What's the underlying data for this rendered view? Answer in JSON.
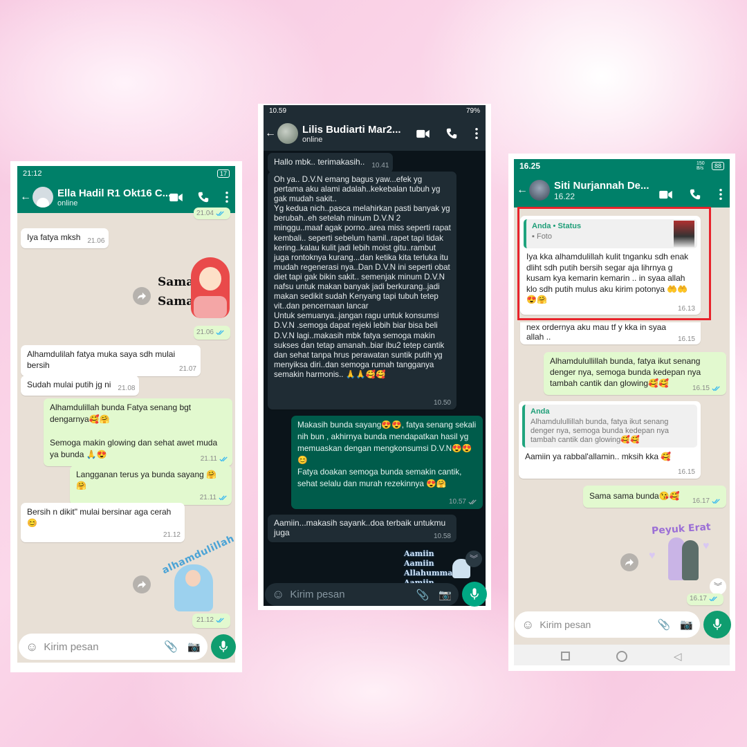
{
  "panel1": {
    "status_time": "21:12",
    "battery": "17",
    "contact": "Ella Hadil R1 Okt16 C...",
    "presence": "online",
    "messages": [
      {
        "time": "21.04"
      },
      {
        "text": "Iya fatya mksh",
        "time": "21.06"
      },
      {
        "sticker_text": "Sama Sama",
        "time": "21.06"
      },
      {
        "text": "Alhamdulilah fatya muka saya sdh mulai bersih",
        "time": "21.07"
      },
      {
        "text": "Sudah mulai putih jg ni",
        "time": "21.08"
      },
      {
        "text": "Alhamdulillah bunda Fatya senang bgt dengarnya🥰🤗\n\nSemoga makin glowing dan sehat awet muda ya bunda 🙏😍",
        "time": "21.11"
      },
      {
        "text": "Langganan terus ya bunda sayang 🤗🤗",
        "time": "21.11"
      },
      {
        "text": "Bersih n dikit\" mulai bersinar aga cerah 😊",
        "time": "21.12"
      },
      {
        "sticker_text": "alhamdulillah",
        "time": "21.12"
      }
    ],
    "input_placeholder": "Kirim pesan"
  },
  "panel2": {
    "status_time": "10.59",
    "battery": "79%",
    "contact": "Lilis Budiarti Mar2...",
    "presence": "online",
    "messages": [
      {
        "text": "Hallo mbk.. terimakasih..",
        "time": "10.41"
      },
      {
        "text": "Oh ya.. D.V.N emang bagus yaw...efek yg pertama aku alami adalah..kekebalan tubuh yg gak mudah sakit..\nYg kedua nich..pasca melahirkan pasti banyak yg berubah..eh setelah minum D.V.N 2 minggu..maaf agak porno..area miss seperti rapat kembali.. seperti sebelum hamil..rapet tapi tidak kering..kalau kulit jadi lebih moist gitu..rambut juga rontoknya kurang...dan ketika kita terluka itu mudah regenerasi nya..Dan D.V.N ini seperti obat diet tapi gak bikin sakit.. semenjak minum D.V.N nafsu untuk makan banyak jadi berkurang..jadi makan sedikit sudah Kenyang tapi tubuh tetep vit..dan pencernaan lancar\nUntuk semuanya..jangan ragu untuk konsumsi D.V.N .semoga dapat rejeki lebih biar bisa beli D.V.N lagi..makasih mbk fatya semoga makin sukses dan tetap amanah..biar ibu2 tetep cantik dan sehat tanpa hrus perawatan suntik putih yg menyiksa diri..dan semoga rumah tangganya semakin harmonis.. 🙏🙏🥰🥰",
        "time": "10.50"
      },
      {
        "text": "Makasih bunda sayang😍😍, fatya senang sekali nih bun , akhirnya bunda mendapatkan hasil yg memuaskan dengan mengkonsumsi D.V.N😍😍😊\nFatya doakan semoga bunda semakin cantik, sehat selalu dan murah rezekinnya 😍🤗",
        "time": "10.57"
      },
      {
        "text": "Aamiin...makasih sayank..doa terbaik untukmu juga",
        "time": "10.58"
      },
      {
        "sticker_text": "Aamiin Aamiin Allahumma Aamiin"
      }
    ],
    "input_placeholder": "Kirim pesan"
  },
  "panel3": {
    "status_time": "16.25",
    "battery": "88",
    "net_speed": "150 B/s",
    "contact": "Siti Nurjannah De...",
    "presence": "16.22",
    "messages": [
      {
        "quote_author": "Anda • Status",
        "quote_text": "Foto",
        "text": "Iya kka alhamdulillah kulit tnganku sdh enak dliht sdh putih bersih segar aja lihrnya g kusam kya kemarin kemarin .. in syaa allah klo sdh putih mulus aku kirim potonya 🤲🤲😍🤗",
        "time": "16.13"
      },
      {
        "text": "nex ordernya aku mau tf y kka in syaa allah ..",
        "time": "16.15"
      },
      {
        "text": "Alhamdulullillah bunda, fatya ikut senang denger nya, semoga bunda kedepan nya tambah cantik dan glowing🥰🥰",
        "time": "16.15"
      },
      {
        "quote_author": "Anda",
        "quote_text": "Alhamdulullillah bunda, fatya ikut senang denger nya, semoga bunda kedepan nya tambah cantik dan glowing🥰🥰",
        "text": "Aamiin ya rabbal'allamin.. mksih kka 🥰",
        "time": "16.15"
      },
      {
        "text": "Sama sama bunda😘🥰",
        "time": "16.17"
      },
      {
        "sticker_text": "Peyuk Erat",
        "time": "16.17"
      }
    ],
    "input_placeholder": "Kirim pesan"
  },
  "colors": {
    "whatsapp_green": "#008069",
    "dark_header": "#1f2c34",
    "highlight_box": "#e8232b",
    "read_tick": "#34b7f1"
  }
}
